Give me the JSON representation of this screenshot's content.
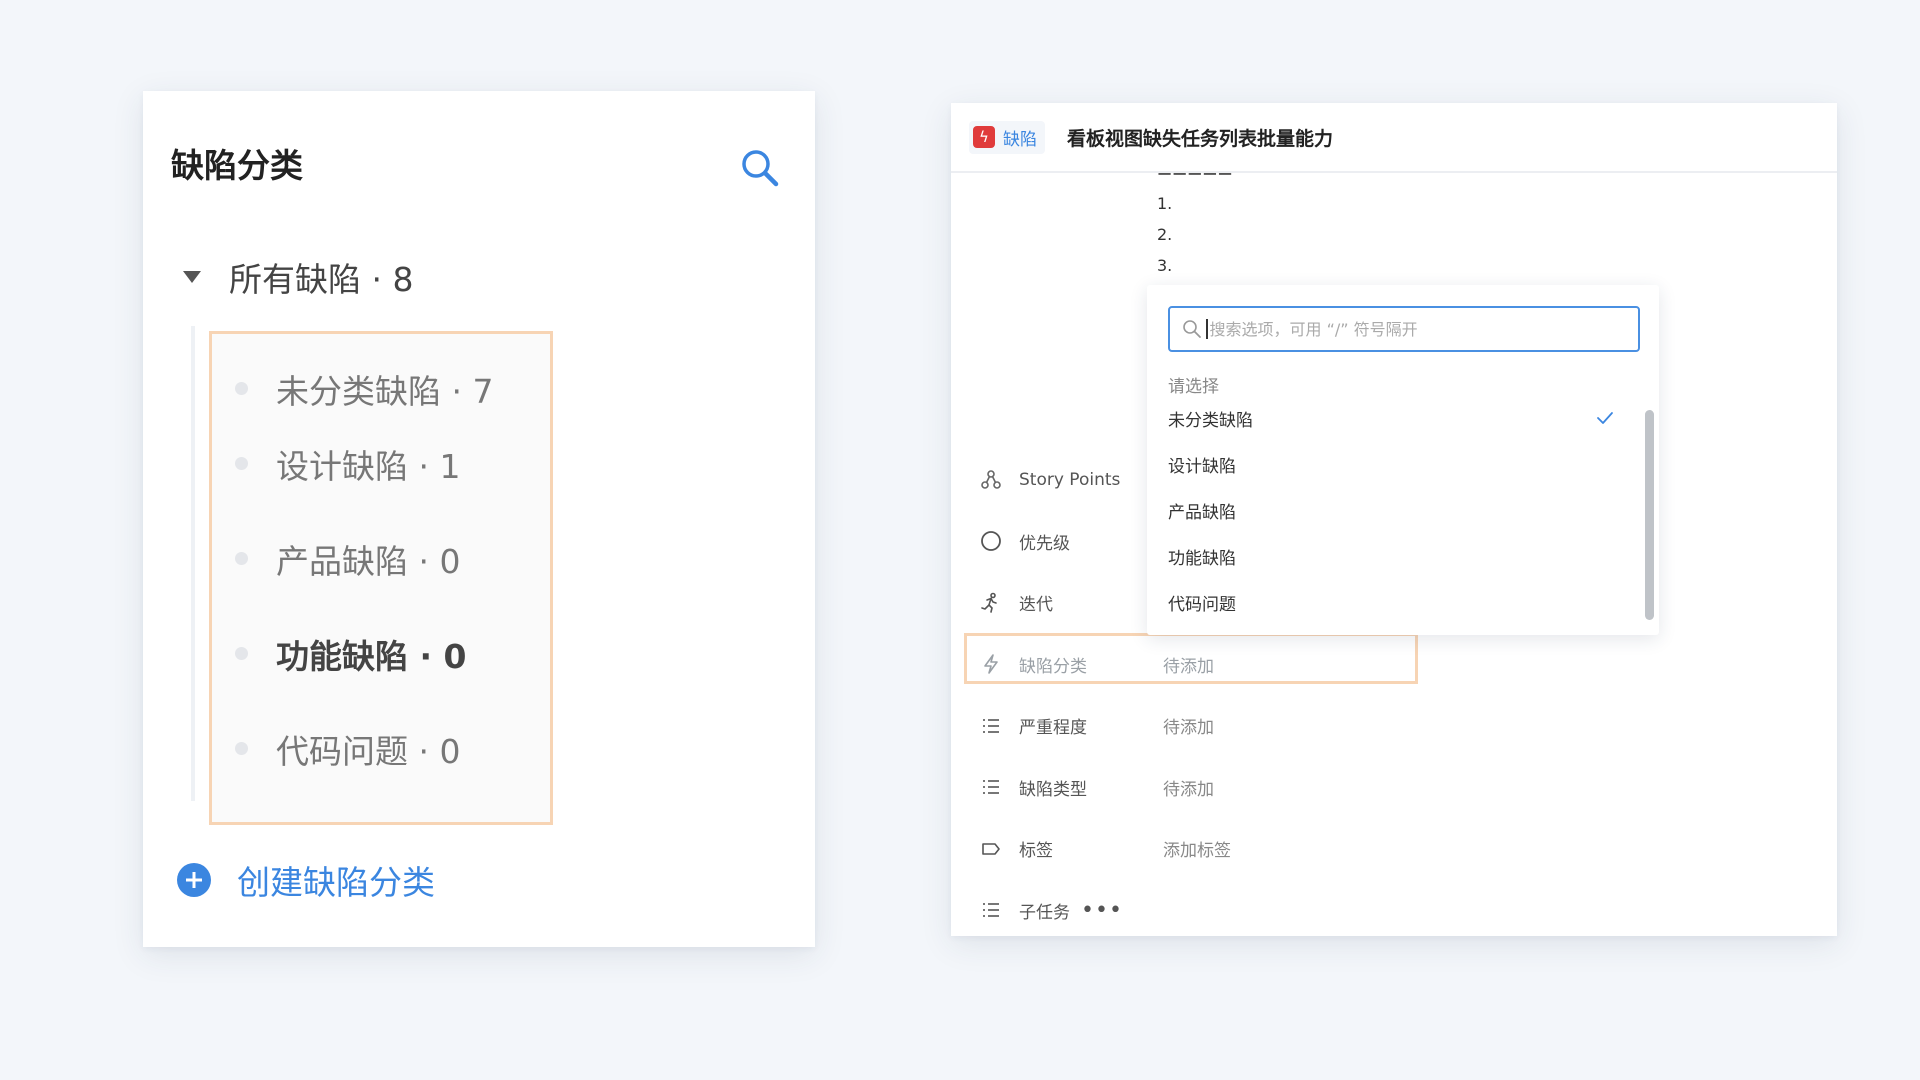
{
  "left_panel": {
    "title": "缺陷分类",
    "root": {
      "label": "所有缺陷 · 8"
    },
    "items": [
      {
        "label": "未分类缺陷 · 7"
      },
      {
        "label": "设计缺陷 · 1"
      },
      {
        "label": "产品缺陷 · 0"
      },
      {
        "label": "功能缺陷 · 0"
      },
      {
        "label": "代码问题 · 0"
      }
    ],
    "create_label": "创建缺陷分类"
  },
  "right_panel": {
    "type_badge": "缺陷",
    "title": "看板视图缺失任务列表批量能力",
    "numbered_list": [
      "1.",
      "2.",
      "3."
    ],
    "properties": [
      {
        "icon": "story-points-icon",
        "label": "Story Points",
        "value": ""
      },
      {
        "icon": "circle-priority-icon",
        "label": "优先级",
        "value": ""
      },
      {
        "icon": "run-iteration-icon",
        "label": "迭代",
        "value": ""
      },
      {
        "icon": "lightning-icon",
        "label": "缺陷分类",
        "value": "待添加"
      },
      {
        "icon": "list-icon",
        "label": "严重程度",
        "value": "待添加"
      },
      {
        "icon": "list-icon",
        "label": "缺陷类型",
        "value": "待添加"
      },
      {
        "icon": "tag-icon",
        "label": "标签",
        "value": "添加标签"
      },
      {
        "icon": "list-icon",
        "label": "子任务",
        "value": ""
      }
    ],
    "more_label": "•••"
  },
  "dropdown": {
    "search_placeholder": "搜索选项，可用 “/” 符号隔开",
    "hint": "请选择",
    "options": [
      {
        "label": "未分类缺陷",
        "selected": true
      },
      {
        "label": "设计缺陷",
        "selected": false
      },
      {
        "label": "产品缺陷",
        "selected": false
      },
      {
        "label": "功能缺陷",
        "selected": false
      },
      {
        "label": "代码问题",
        "selected": false
      }
    ]
  },
  "colors": {
    "accent": "#3b86e0",
    "highlight_border": "#f7d4b4",
    "defect_red": "#e03b3b",
    "background": "#f3f6fa"
  }
}
